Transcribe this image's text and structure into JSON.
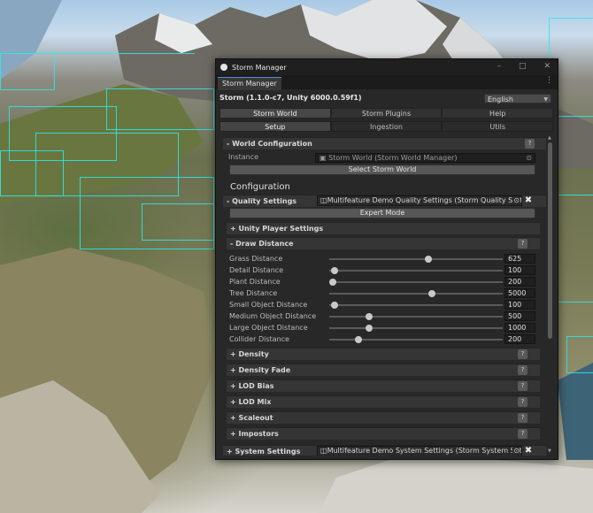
{
  "window": {
    "title": "Storm Manager",
    "tab": "Storm Manager",
    "header": "Storm (1.1.0-c7, Unity 6000.0.59f1)",
    "language": "English"
  },
  "tabs": {
    "top": [
      "Storm World",
      "Storm Plugins",
      "Help"
    ],
    "sub": [
      "Setup",
      "Ingestion",
      "Utils"
    ]
  },
  "world_config": {
    "title": "- World Configuration",
    "instance_label": "Instance",
    "instance_value": "Storm World (Storm World Manager)",
    "select_button": "Select Storm World"
  },
  "configuration_heading": "Configuration",
  "quality": {
    "label": "- Quality Settings",
    "value": "Multifeature Demo Quality Settings (Storm Quality Settin",
    "expert_button": "Expert Mode"
  },
  "unity_player": "+ Unity Player Settings",
  "draw_distance": {
    "title": "- Draw Distance",
    "rows": [
      {
        "label": "Grass Distance",
        "value": "625",
        "fraction": 0.57
      },
      {
        "label": "Detail Distance",
        "value": "100",
        "fraction": 0.03
      },
      {
        "label": "Plant Distance",
        "value": "200",
        "fraction": 0.02
      },
      {
        "label": "Tree Distance",
        "value": "5000",
        "fraction": 0.59
      },
      {
        "label": "Small Object Distance",
        "value": "100",
        "fraction": 0.03
      },
      {
        "label": "Medium Object Distance",
        "value": "500",
        "fraction": 0.23
      },
      {
        "label": "Large Object Distance",
        "value": "1000",
        "fraction": 0.23
      },
      {
        "label": "Collider Distance",
        "value": "200",
        "fraction": 0.17
      }
    ]
  },
  "collapsed_sections": [
    "+ Density",
    "+ Density Fade",
    "+ LOD Bias",
    "+ LOD Mix",
    "+ Scaleout",
    "+ Impostors"
  ],
  "system": {
    "label": "+ System Settings",
    "value": "Multifeature Demo System Settings (Storm System Sett"
  },
  "help_glyph": "?",
  "colors": {
    "accent": "#4a90d9",
    "panel": "#282828",
    "section": "#353535",
    "wireframe": "#28ebeb"
  }
}
